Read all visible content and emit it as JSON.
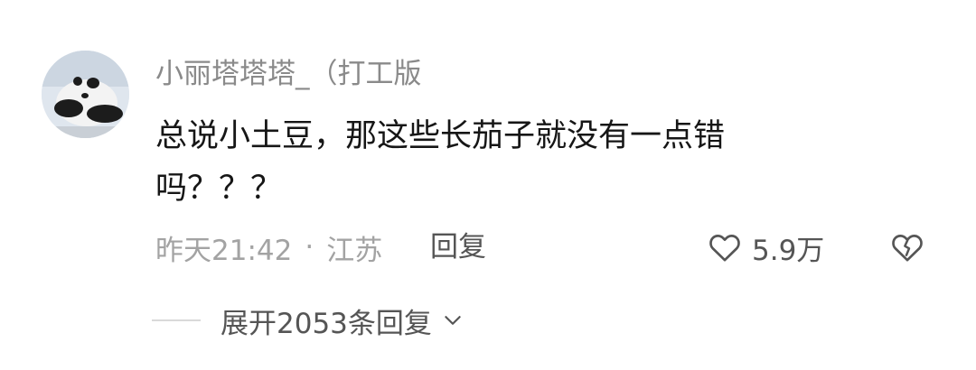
{
  "comment": {
    "username": "小丽塔塔塔_（打工版",
    "text": "总说小土豆，那这些长茄子就没有一点错吗？？？",
    "time": "昨天21:42",
    "separator": "·",
    "location": "江苏",
    "reply_label": "回复",
    "like_count": "5.9万",
    "expand_label": "展开2053条回复"
  },
  "icons": {
    "avatar": "panda-avatar",
    "like": "heart-outline-icon",
    "dislike": "broken-heart-icon",
    "expand": "chevron-down-icon"
  },
  "colors": {
    "username": "#8a8a8a",
    "text": "#161616",
    "meta": "#a3a3a3",
    "action": "#555555",
    "divider": "#d9d9d9"
  }
}
